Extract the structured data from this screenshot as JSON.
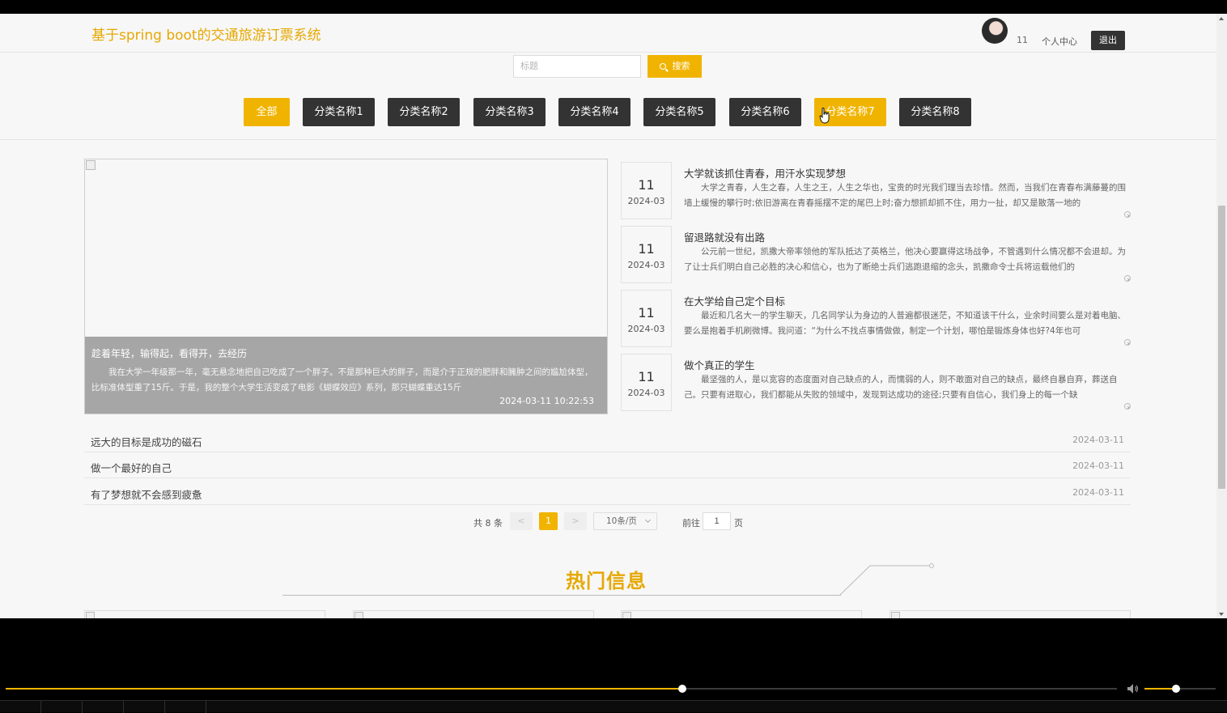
{
  "header": {
    "site_title": "基于spring boot的交通旅游订票系统",
    "user_name": "11",
    "profile_link": "个人中心",
    "logout": "退出"
  },
  "search": {
    "placeholder": "标题",
    "button": "搜索"
  },
  "categories": [
    "全部",
    "分类名称1",
    "分类名称2",
    "分类名称3",
    "分类名称4",
    "分类名称5",
    "分类名称6",
    "分类名称7",
    "分类名称8"
  ],
  "featured": {
    "title": "趁着年轻，输得起，看得开，去经历",
    "text": "我在大学一年级那一年，毫无悬念地把自己吃成了一个胖子。不是那种巨大的胖子，而是介于正规的肥胖和臃肿之间的尴尬体型，比标准体型重了15斤。于是，我的整个大学生活变成了电影《蝴蝶效应》系列，那只蝴蝶重达15斤",
    "date": "2024-03-11 10:22:53"
  },
  "news": [
    {
      "day": "11",
      "ym": "2024-03",
      "title": "大学就该抓住青春，用汗水实现梦想",
      "desc": "大学之青春，人生之春，人生之王，人生之华也，宝贵的时光我们理当去珍惜。然而，当我们在青春布满藤蔓的围墙上缓慢的攀行时;依旧游离在青春摇摆不定的尾巴上时;奋力想抓却抓不住，用力一扯，却又是散落一地的"
    },
    {
      "day": "11",
      "ym": "2024-03",
      "title": "留退路就没有出路",
      "desc": "公元前一世纪，凯撒大帝率领他的军队抵达了英格兰，他决心要赢得这场战争，不管遇到什么情况都不会退却。为了让士兵们明白自己必胜的决心和信心，也为了断绝士兵们逃跑退缩的念头，凯撒命令士兵将运载他们的"
    },
    {
      "day": "11",
      "ym": "2024-03",
      "title": "在大学给自己定个目标",
      "desc": "最近和几名大一的学生聊天，几名同学认为身边的人普遍都很迷茫，不知道该干什么，业余时间要么是对着电脑、要么是抱着手机刷微博。我问道：“为什么不找点事情做做，制定一个计划，哪怕是锻炼身体也好?4年也可"
    },
    {
      "day": "11",
      "ym": "2024-03",
      "title": "做个真正的学生",
      "desc": "最坚强的人，是以宽容的态度面对自己缺点的人，而懦弱的人，则不敢面对自己的缺点，最终自暴自弃，葬送自己。只要有进取心，我们都能从失败的领域中，发现到达成功的途径;只要有自信心，我们身上的每一个缺"
    }
  ],
  "rows": [
    {
      "title": "远大的目标是成功的磁石",
      "date": "2024-03-11"
    },
    {
      "title": "做一个最好的自己",
      "date": "2024-03-11"
    },
    {
      "title": "有了梦想就不会感到疲惫",
      "date": "2024-03-11"
    }
  ],
  "pagination": {
    "total": "共 8 条",
    "prev": "<",
    "current": "1",
    "next": ">",
    "page_size": "10条/页",
    "goto_label": "前往",
    "goto_value": "1",
    "page_suffix": "页"
  },
  "hot": {
    "title": "热门信息"
  },
  "player": {
    "seek_progress": 0.609,
    "volume_level": 0.44,
    "accent_color": "#f0b400"
  },
  "colors": {
    "accent": "#f0b400",
    "title": "#e6a800",
    "dark_button": "#333333"
  }
}
